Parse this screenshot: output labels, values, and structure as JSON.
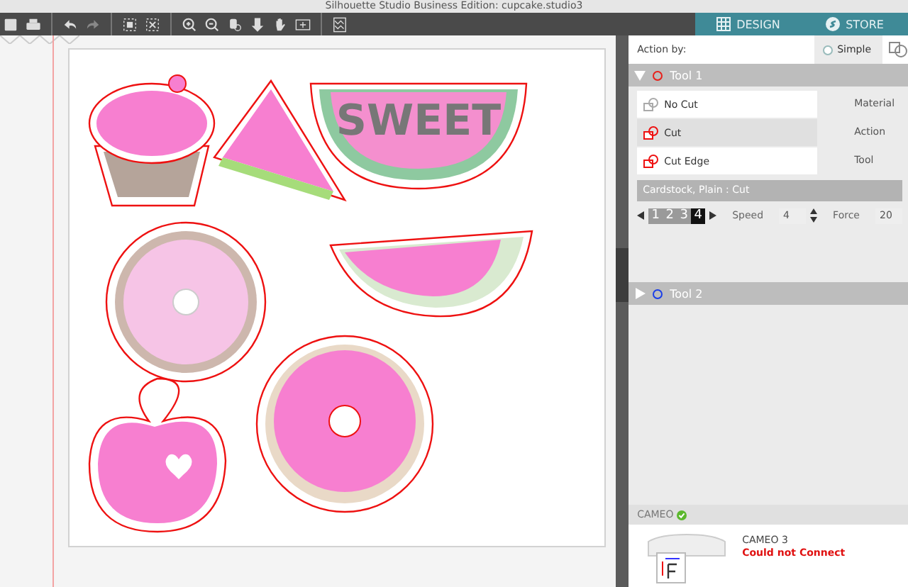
{
  "window": {
    "title": "Silhouette Studio Business Edition: cupcake.studio3"
  },
  "nav_tabs": [
    {
      "label": "DESIGN",
      "kind": "grid"
    },
    {
      "label": "STORE",
      "kind": "logo"
    }
  ],
  "artwork": {
    "text": "SWEET"
  },
  "action_by": {
    "label": "Action by:",
    "options": [
      {
        "label": "Simple",
        "selected": false
      }
    ]
  },
  "tools": [
    {
      "name": "Tool 1",
      "color": "#e8201a",
      "expanded": true,
      "actions": [
        {
          "label": "No Cut",
          "selected": false,
          "kind": "none"
        },
        {
          "label": "Cut",
          "selected": true,
          "kind": "cut"
        },
        {
          "label": "Cut Edge",
          "selected": false,
          "kind": "edge"
        }
      ],
      "labels": [
        "Material",
        "Action",
        "Tool"
      ],
      "material": "Cardstock, Plain : Cut",
      "passes": [
        {
          "label": "1",
          "selected": false
        },
        {
          "label": "2",
          "selected": false
        },
        {
          "label": "3",
          "selected": false
        },
        {
          "label": "4",
          "selected": true
        }
      ],
      "speed_label": "Speed",
      "speed": "4",
      "force_label": "Force",
      "force": "20"
    },
    {
      "name": "Tool 2",
      "color": "#1a3ee8",
      "expanded": false
    }
  ],
  "device": {
    "header": "CAMEO",
    "name": "CAMEO 3",
    "status": "Could not Connect"
  }
}
